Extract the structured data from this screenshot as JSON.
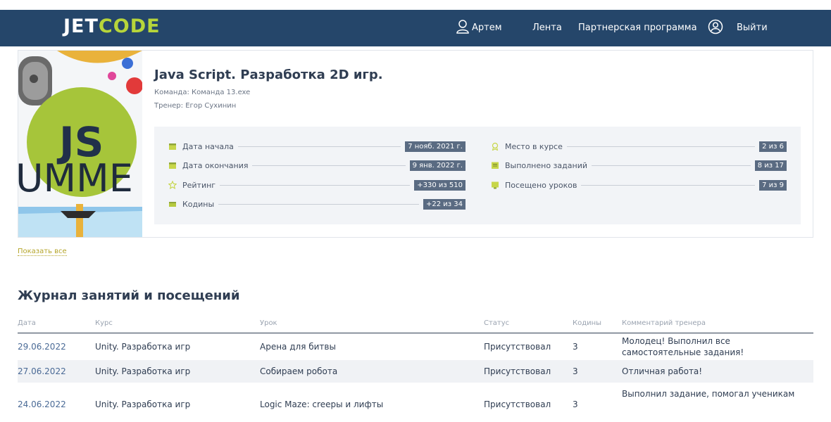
{
  "header": {
    "logo_part1": "JET",
    "logo_part2": "CODE",
    "user_name": "Артем",
    "feed_label": "Лента",
    "partner_label": "Партнерская программа",
    "logout_label": "Выйти",
    "colors": {
      "bar": "#25466a",
      "accent": "#b7d53a"
    }
  },
  "course": {
    "title": "Java Script. Разработка 2D игр.",
    "team": "Команда: Команда 13.exe",
    "trainer": "Тренер: Егор Сухинин",
    "image_text_1": "JS",
    "image_text_2": "UMME",
    "stats_left": [
      {
        "icon": "calendar-icon",
        "label": "Дата начала",
        "value": "7 нояб. 2021 г."
      },
      {
        "icon": "calendar-icon",
        "label": "Дата окончания",
        "value": "9 янв. 2022 г."
      },
      {
        "icon": "star-icon",
        "label": "Рейтинг",
        "value": "+330 из 510"
      },
      {
        "icon": "coins-icon",
        "label": "Кодины",
        "value": "+22 из 34"
      }
    ],
    "stats_right": [
      {
        "icon": "award-icon",
        "label": "Место в курсе",
        "value": "2 из 6"
      },
      {
        "icon": "tasks-icon",
        "label": "Выполнено заданий",
        "value": "8 из 17"
      },
      {
        "icon": "lessons-icon",
        "label": "Посещено уроков",
        "value": "7 из 9"
      }
    ]
  },
  "show_all_label": "Показать все",
  "journal": {
    "title": "Журнал занятий и посещений",
    "columns": [
      "Дата",
      "Курс",
      "Урок",
      "Статус",
      "Кодины",
      "Комментарий тренера"
    ],
    "rows": [
      {
        "date": "29.06.2022",
        "course": "Unity. Разработка игр",
        "lesson": "Арена для битвы",
        "status": "Присутствовал",
        "codins": "3",
        "comment": "Молодец! Выполнил все самостоятельные задания!"
      },
      {
        "date": "27.06.2022",
        "course": "Unity. Разработка игр",
        "lesson": "Собираем робота",
        "status": "Присутствовал",
        "codins": "3",
        "comment": "Отличная работа!"
      },
      {
        "date": "24.06.2022",
        "course": "Unity. Разработка игр",
        "lesson": "Logic Maze: creepы и лифты",
        "status": "Присутствовал",
        "codins": "3",
        "comment": "Выполнил задание, помогал ученикам"
      }
    ]
  }
}
